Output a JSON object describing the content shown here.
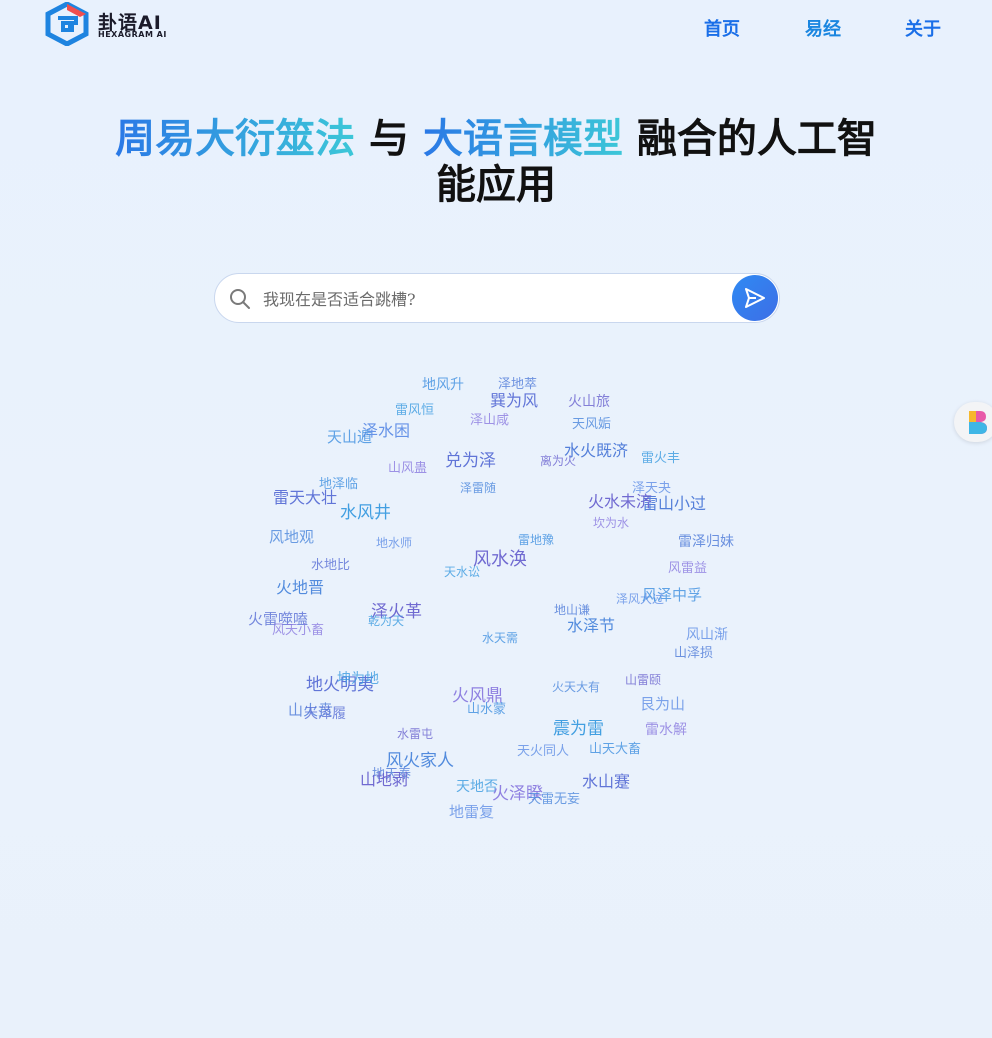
{
  "brand": {
    "name_cn": "卦语AI",
    "name_en": "HEXAGRAM AI"
  },
  "nav": [
    {
      "label": "首页",
      "active": false
    },
    {
      "label": "易经",
      "active": true
    },
    {
      "label": "关于",
      "active": false
    }
  ],
  "hero": {
    "highlight_1": "周易大衍筮法",
    "text_1": " 与 ",
    "highlight_2": "大语言模型",
    "text_2": " 融合的人工智能应用"
  },
  "search": {
    "placeholder": "我现在是否适合跳槽?",
    "value": ""
  },
  "colors": {
    "accent": "#1a6fe8",
    "gradient_start": "#2a78e6",
    "gradient_end": "#3cc7d8"
  },
  "hexagram_cloud": [
    "地风升",
    "泽地萃",
    "巽为风",
    "火山旅",
    "雷风恒",
    "泽山咸",
    "天风姤",
    "泽水困",
    "天山遁",
    "水火既济",
    "兑为泽",
    "离为火",
    "雷火丰",
    "山风蛊",
    "泽雷随",
    "泽天夬",
    "地泽临",
    "雷山小过",
    "雷天大壮",
    "火水未济",
    "水风井",
    "坎为水",
    "风地观",
    "地水师",
    "雷地豫",
    "雷泽归妹",
    "水地比",
    "风水涣",
    "天水讼",
    "风雷益",
    "火地晋",
    "泽风大过",
    "风泽中孚",
    "地山谦",
    "火雷噬嗑",
    "泽火革",
    "乾为天",
    "风天小畜",
    "水泽节",
    "风山渐",
    "水天需",
    "山泽损",
    "地火明夷",
    "山雷颐",
    "坤为地",
    "火风鼎",
    "火天大有",
    "艮为山",
    "山水蒙",
    "山火贲",
    "天泽履",
    "水雷屯",
    "震为雷",
    "雷水解",
    "风火家人",
    "天火同人",
    "山天大畜",
    "地天泰",
    "水山蹇",
    "山地剥",
    "天地否",
    "火泽睽",
    "天雷无妄",
    "地雷复"
  ]
}
